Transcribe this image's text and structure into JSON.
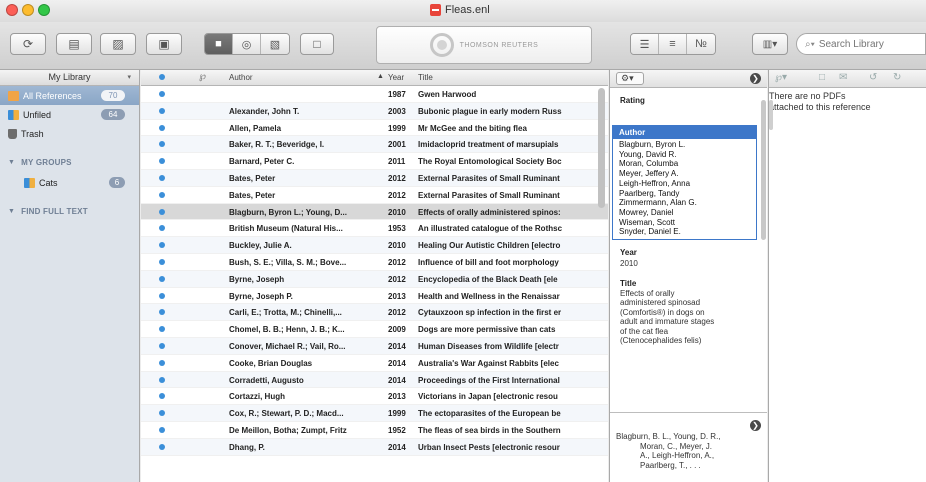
{
  "window": {
    "title": "Fleas.enl"
  },
  "toolbar": {
    "logo_text": "THOMSON REUTERS",
    "search_placeholder": "Search Library"
  },
  "sidebar": {
    "header": "My Library",
    "items": [
      {
        "label": "All References",
        "count": "70",
        "selected": true
      },
      {
        "label": "Unfiled",
        "count": "64"
      },
      {
        "label": "Trash",
        "count": ""
      }
    ],
    "groups_header": "MY GROUPS",
    "groups": [
      {
        "label": "Cats",
        "count": "6"
      }
    ],
    "find_full_text": "FIND FULL TEXT"
  },
  "list": {
    "columns": {
      "author": "Author",
      "year": "Year",
      "title": "Title"
    },
    "rows": [
      {
        "author": "",
        "year": "1987",
        "title": "Gwen Harwood"
      },
      {
        "author": "Alexander, John T.",
        "year": "2003",
        "title": "Bubonic plague in early modern Russ"
      },
      {
        "author": "Allen, Pamela",
        "year": "1999",
        "title": "Mr McGee and the biting flea"
      },
      {
        "author": "Baker, R. T.; Beveridge, I.",
        "year": "2001",
        "title": "Imidacloprid treatment of marsupials"
      },
      {
        "author": "Barnard, Peter C.",
        "year": "2011",
        "title": "The Royal Entomological Society Boc"
      },
      {
        "author": "Bates, Peter",
        "year": "2012",
        "title": "External Parasites of Small Ruminant"
      },
      {
        "author": "Bates, Peter",
        "year": "2012",
        "title": "External Parasites of Small Ruminant"
      },
      {
        "author": "Blagburn, Byron L.; Young, D...",
        "year": "2010",
        "title": "Effects of orally administered spinos:"
      },
      {
        "author": "British Museum (Natural His...",
        "year": "1953",
        "title": "An illustrated catalogue of the Rothsc"
      },
      {
        "author": "Buckley, Julie A.",
        "year": "2010",
        "title": "Healing Our Autistic Children [electro"
      },
      {
        "author": "Bush, S. E.; Villa, S. M.; Bove...",
        "year": "2012",
        "title": "Influence of bill and foot morphology"
      },
      {
        "author": "Byrne, Joseph",
        "year": "2012",
        "title": "Encyclopedia of the Black Death [ele"
      },
      {
        "author": "Byrne, Joseph P.",
        "year": "2013",
        "title": "Health and Wellness in the Renaissar"
      },
      {
        "author": "Carli, E.; Trotta, M.; Chinelli,...",
        "year": "2012",
        "title": "Cytauxzoon sp infection in the first er"
      },
      {
        "author": "Chomel, B. B.; Henn, J. B.; K...",
        "year": "2009",
        "title": "Dogs are more permissive than cats"
      },
      {
        "author": "Conover, Michael R.; Vail, Ro...",
        "year": "2014",
        "title": "Human Diseases from Wildlife [electr"
      },
      {
        "author": "Cooke, Brian Douglas",
        "year": "2014",
        "title": "Australia's War Against Rabbits [elec"
      },
      {
        "author": "Corradetti, Augusto",
        "year": "2014",
        "title": "Proceedings of the First International"
      },
      {
        "author": "Cortazzi, Hugh",
        "year": "2013",
        "title": "Victorians in Japan [electronic resou"
      },
      {
        "author": "Cox, R.; Stewart, P. D.; Macd...",
        "year": "1999",
        "title": "The ectoparasites of the European be"
      },
      {
        "author": "De Meillon, Botha; Zumpt, Fritz",
        "year": "1952",
        "title": "The fleas of sea birds in the Southern"
      },
      {
        "author": "Dhang, P.",
        "year": "2014",
        "title": "Urban Insect Pests [electronic resour"
      }
    ]
  },
  "detail": {
    "rating_label": "Rating",
    "author_label": "Author",
    "authors": [
      "Blagburn, Byron L.",
      "Young, David R.",
      "Moran, Columba",
      "Meyer, Jeffery A.",
      "Leigh-Heffron, Anna",
      "Paarlberg, Tandy",
      "Zimmermann, Alan G.",
      "Mowrey, Daniel",
      "Wiseman, Scott",
      "Snyder, Daniel E."
    ],
    "year_label": "Year",
    "year": "2010",
    "title_label": "Title",
    "title_lines": [
      "Effects of orally",
      "administered spinosad",
      "(Comfortis®) in dogs on",
      "adult and immature stages",
      "of the cat flea",
      "(Ctenocephalides felis)"
    ],
    "preview_lines": [
      "Blagburn, B. L., Young, D. R.,",
      "Moran, C., Meyer, J.",
      "A., Leigh-Heffron, A.,",
      "Paarlberg, T., . . ."
    ]
  },
  "pdf": {
    "message": "There are no PDFs attached to this reference"
  }
}
